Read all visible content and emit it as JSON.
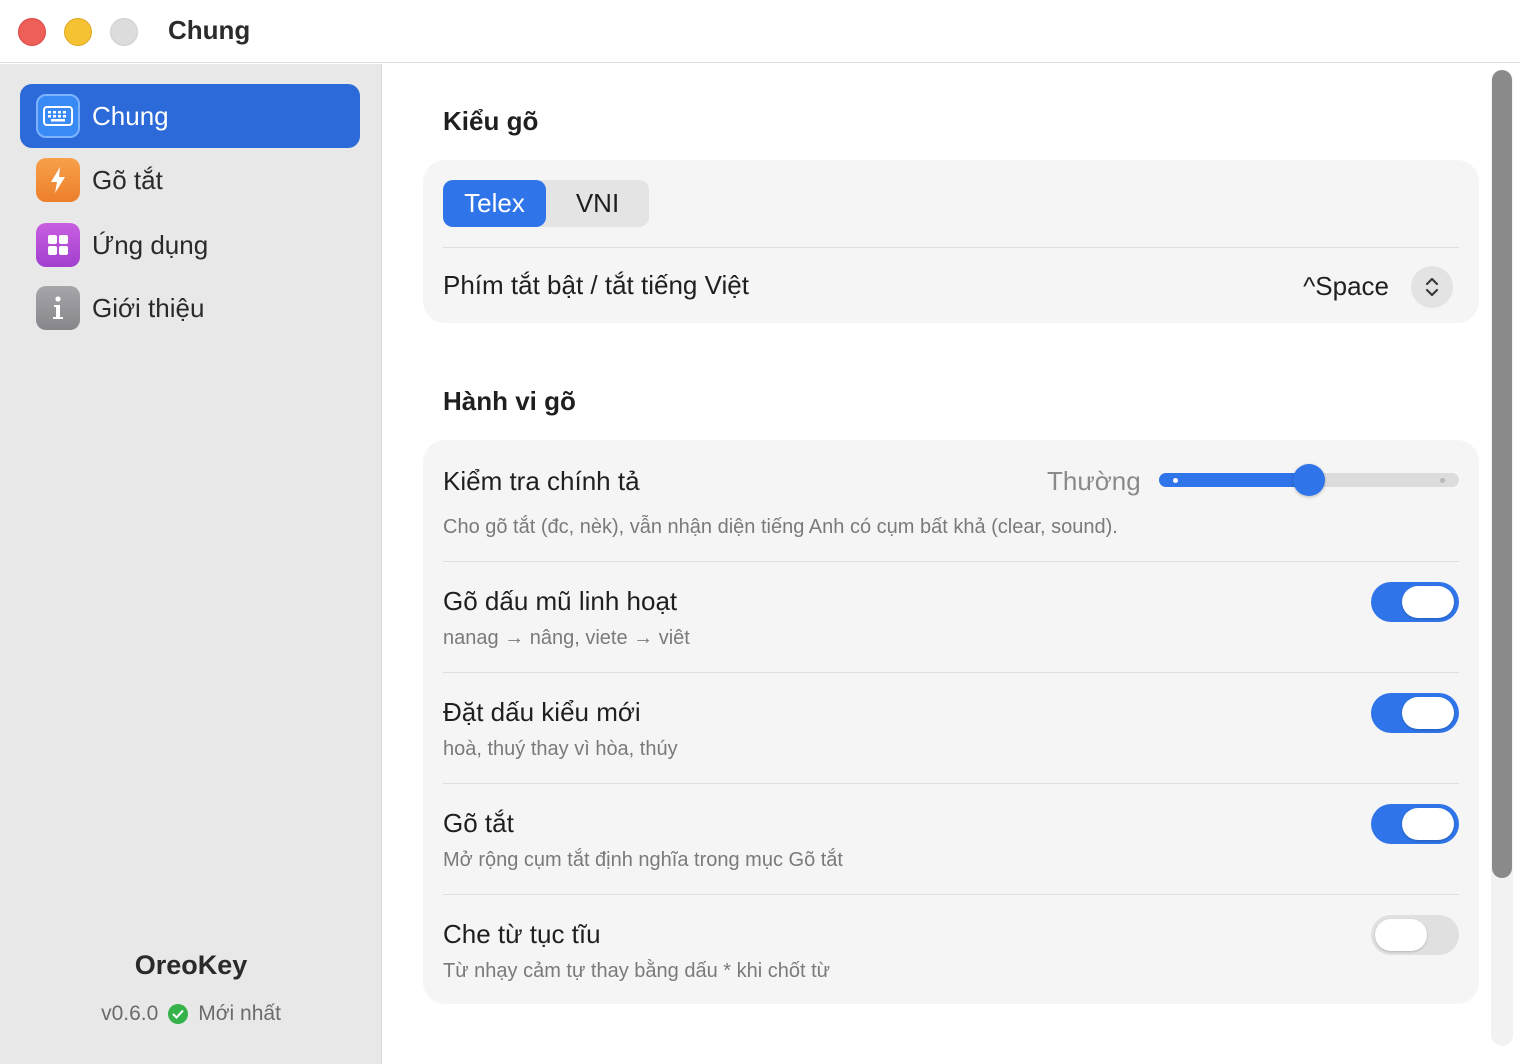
{
  "window": {
    "title": "Chung"
  },
  "sidebar": {
    "items": [
      {
        "label": "Chung",
        "icon": "keyboard-icon",
        "active": true
      },
      {
        "label": "Gõ tắt",
        "icon": "bolt-icon",
        "active": false
      },
      {
        "label": "Ứng dụng",
        "icon": "apps-grid-icon",
        "active": false
      },
      {
        "label": "Giới thiệu",
        "icon": "info-icon",
        "active": false
      }
    ],
    "brand": "OreoKey",
    "version": "v0.6.0",
    "status": "Mới nhất"
  },
  "typing_mode": {
    "title": "Kiểu gõ",
    "options": [
      "Telex",
      "VNI"
    ],
    "selected": "Telex",
    "shortcut_label": "Phím tắt bật / tắt tiếng Việt",
    "shortcut_value": "^Space"
  },
  "behavior": {
    "title": "Hành vi gõ",
    "spellcheck": {
      "label": "Kiểm tra chính tả",
      "level_label": "Thường",
      "level_fraction": 0.5,
      "description": "Cho gõ tắt (đc, nèk), vẫn nhận diện tiếng Anh có cụm bất khả (clear, sound)."
    },
    "toggles": [
      {
        "label": "Gõ dấu mũ linh hoạt",
        "description": "nanag → nâng, viete → viêt",
        "on": true
      },
      {
        "label": "Đặt dấu kiểu mới",
        "description": "hoà, thuý thay vì hòa, thúy",
        "on": true
      },
      {
        "label": "Gõ tắt",
        "description": "Mở rộng cụm tắt định nghĩa trong mục Gõ tắt",
        "on": true
      },
      {
        "label": "Che từ tục tĩu",
        "description": "Từ nhạy cảm tự thay bằng dấu * khi chốt từ",
        "on": false
      }
    ]
  },
  "colors": {
    "accent": "#2f74e8",
    "sidebar_active": "#2b6ad8",
    "success": "#35b24a"
  }
}
